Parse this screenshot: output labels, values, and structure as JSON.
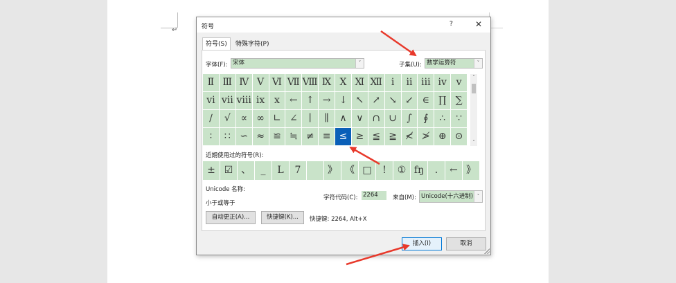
{
  "document": {
    "paragraph_mark": "↵"
  },
  "dialog": {
    "title": "符号",
    "help": "?",
    "close": "✕",
    "tabs": [
      "符号(S)",
      "特殊字符(P)"
    ],
    "font_label": "字体(F):",
    "font_value": "宋体",
    "subset_label": "子集(U):",
    "subset_value": "数学运算符",
    "dropdown_arrow": "˅",
    "symbols": [
      [
        "Ⅱ",
        "Ⅲ",
        "Ⅳ",
        "Ⅴ",
        "Ⅵ",
        "Ⅶ",
        "Ⅷ",
        "Ⅸ",
        "Ⅹ",
        "Ⅺ",
        "Ⅻ",
        "ⅰ",
        "ⅱ",
        "ⅲ",
        "ⅳ",
        "ⅴ"
      ],
      [
        "ⅵ",
        "ⅶ",
        "ⅷ",
        "ⅸ",
        "ⅹ",
        "←",
        "↑",
        "→",
        "↓",
        "↖",
        "↗",
        "↘",
        "↙",
        "∈",
        "∏",
        "∑"
      ],
      [
        "∕",
        "√",
        "∝",
        "∞",
        "∟",
        "∠",
        "∣",
        "∥",
        "∧",
        "∨",
        "∩",
        "∪",
        "∫",
        "∮",
        "∴",
        "∵"
      ],
      [
        "∶",
        "∷",
        "∽",
        "≈",
        "≌",
        "≒",
        "≠",
        "≡",
        "≤",
        "≥",
        "≦",
        "≧",
        "≮",
        "≯",
        "⊕",
        "⊙"
      ]
    ],
    "selected_row": 3,
    "selected_col": 8,
    "recent_label": "近期使用过的符号(R):",
    "recent_symbols": [
      "±",
      "☑",
      "、",
      "_",
      "L",
      "7",
      "",
      "》",
      "《",
      "□",
      "!",
      "①",
      "fŋ",
      ".",
      "←",
      "》"
    ],
    "unicode_name_label": "Unicode 名称:",
    "unicode_name_value": "小于或等于",
    "char_code_label": "字符代码(C):",
    "char_code_value": "2264",
    "from_label": "来自(M):",
    "from_value": "Unicode(十六进制)",
    "autocorrect_label": "自动更正(A)...",
    "shortcut_key_label": "快捷键(K)...",
    "shortcut_text": "快捷键: 2264, Alt+X",
    "insert_label": "插入(I)",
    "cancel_label": "取消",
    "scroll_up": "˄",
    "scroll_down": "˅"
  },
  "colors": {
    "accent": "#0a5fb8",
    "cell_bg": "#c9e3c9",
    "annotation": "#e8392b"
  }
}
